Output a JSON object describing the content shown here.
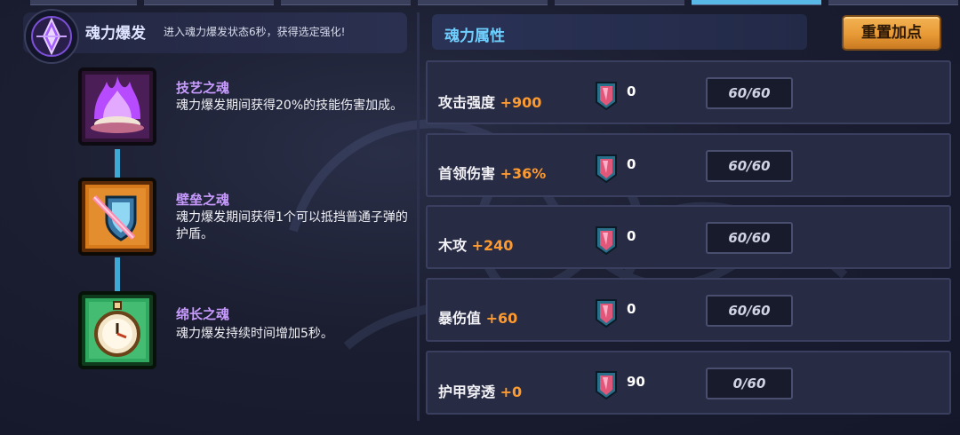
{
  "burst": {
    "title": "魂力爆发",
    "description": "进入魂力爆发状态6秒，获得选定强化!"
  },
  "skills": [
    {
      "name": "技艺之魂",
      "description": "魂力爆发期间获得20%的技能伤害加成。",
      "icon": "purple-flame-icon"
    },
    {
      "name": "壁垒之魂",
      "description": "魂力爆发期间获得1个可以抵挡普通子弹的护盾。",
      "icon": "shield-sword-icon"
    },
    {
      "name": "绵长之魂",
      "description": "魂力爆发持续时间增加5秒。",
      "icon": "stopwatch-icon"
    }
  ],
  "attributes": {
    "title": "魂力属性",
    "reset_label": "重置加点",
    "rows": [
      {
        "label": "攻击强度",
        "bonus": "+900",
        "count": "0",
        "level": "60/60"
      },
      {
        "label": "首领伤害",
        "bonus": "+36%",
        "count": "0",
        "level": "60/60"
      },
      {
        "label": "木攻",
        "bonus": "+240",
        "count": "0",
        "level": "60/60"
      },
      {
        "label": "暴伤值",
        "bonus": "+60",
        "count": "0",
        "level": "60/60"
      },
      {
        "label": "护甲穿透",
        "bonus": "+0",
        "count": "90",
        "level": "0/60"
      }
    ]
  },
  "colors": {
    "accent_blue": "#6fd0ff",
    "skill_name": "#c89bff",
    "bonus_orange": "#ff9a2e",
    "button_orange": "#e89a36"
  }
}
